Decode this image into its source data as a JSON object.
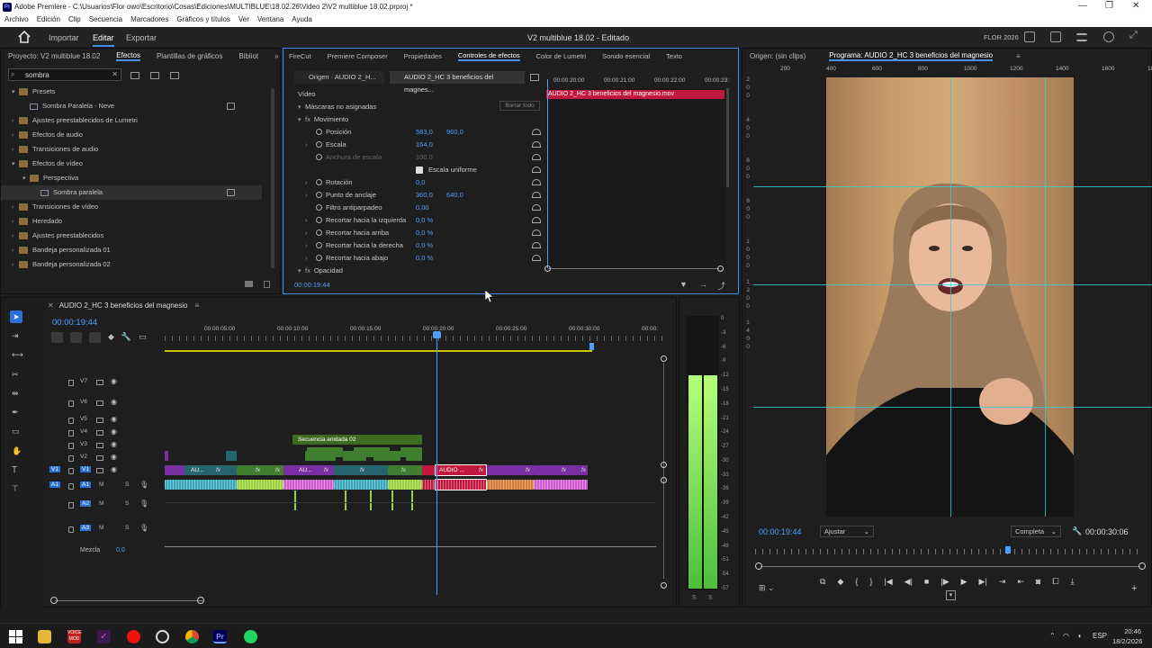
{
  "window": {
    "title": "Adobe Premiere - C:\\Usuarios\\Flor owo\\Escritorio\\Cosas\\Ediciones\\MULTIBLUE\\18.02.26\\Video 2\\V2 multiblue 18.02.prproj *"
  },
  "menu": [
    "Archivo",
    "Edición",
    "Clip",
    "Secuencia",
    "Marcadores",
    "Gráficos y títulos",
    "Ver",
    "Ventana",
    "Ayuda"
  ],
  "workspace": {
    "import": "Importar",
    "edit": "Editar",
    "export": "Exportar",
    "project_title": "V2 multiblue 18.02 - Editado",
    "user": "FLOR 2026"
  },
  "effects_panel": {
    "tabs": [
      "Proyecto: V2 multiblue 18.02",
      "Efectos",
      "Plantillas de gráficos",
      "Bibliot"
    ],
    "search": "sombra",
    "tree": [
      {
        "label": "Presets",
        "kind": "folder",
        "open": true,
        "indent": 0
      },
      {
        "label": "Sombra Paralela - Neve",
        "kind": "preset",
        "indent": 1
      },
      {
        "label": "Ajustes preestablecidos de Lumetri",
        "kind": "folder",
        "indent": 0
      },
      {
        "label": "Efectos de audio",
        "kind": "folder",
        "indent": 0
      },
      {
        "label": "Transiciones de audio",
        "kind": "folder",
        "indent": 0
      },
      {
        "label": "Efectos de vídeo",
        "kind": "folder",
        "open": true,
        "indent": 0
      },
      {
        "label": "Perspectiva",
        "kind": "folder",
        "open": true,
        "indent": 1
      },
      {
        "label": "Sombra paralela",
        "kind": "preset",
        "indent": 2,
        "selected": true
      },
      {
        "label": "Transiciones de vídeo",
        "kind": "folder",
        "indent": 0
      },
      {
        "label": "Heredado",
        "kind": "folder",
        "indent": 0
      },
      {
        "label": "Ajustes preestablecidos",
        "kind": "folder",
        "indent": 0
      },
      {
        "label": "Bandeja personalizada 01",
        "kind": "folder",
        "indent": 0
      },
      {
        "label": "Bandeja personalizada 02",
        "kind": "folder",
        "indent": 0
      }
    ]
  },
  "effect_controls": {
    "tabs": [
      "FireCut",
      "Premiere Composer",
      "Propiedades",
      "Controles de efectos",
      "Color de Lumetri",
      "Sonido esencial",
      "Texto"
    ],
    "source_tab": "Origen · AUDIO 2_H...",
    "seq_tab": "AUDIO 2_HC 3 beneficios del magnes...",
    "video_label": "Vídeo",
    "masks": "Máscaras no asignadas",
    "clear": "Borrar todo",
    "motion": "Movimiento",
    "rows": [
      {
        "label": "Posición",
        "v1": "583,0",
        "v2": "960,0"
      },
      {
        "label": "Escala",
        "v1": "164,0"
      },
      {
        "label": "Anchura de escala",
        "v1": "100,0",
        "disabled": true
      },
      {
        "label": "Escala uniforme",
        "checkbox": true
      },
      {
        "label": "Rotación",
        "v1": "0,0"
      },
      {
        "label": "Punto de anclaje",
        "v1": "360,0",
        "v2": "640,0"
      },
      {
        "label": "Filtro antiparpadeo",
        "v1": "0,00"
      },
      {
        "label": "Recortar hacia la izquierda",
        "v1": "0,0 %"
      },
      {
        "label": "Recortar hacia arriba",
        "v1": "0,0 %"
      },
      {
        "label": "Recortar hacia la derecha",
        "v1": "0,0 %"
      },
      {
        "label": "Recortar hacia abajo",
        "v1": "0,0 %"
      }
    ],
    "opacity": "Opacidad",
    "timecode": "00:00:19:44",
    "mini_ruler": [
      "00:00:20:00",
      "00:00:21:00",
      "00:00:22:00",
      "00:00:23:"
    ],
    "clip_name": "AUDIO 2_HC 3 beneficios del magnesio.mov"
  },
  "program": {
    "tabs": [
      "Origen: (sin clips)",
      "Programa: AUDIO 2_HC 3 beneficios del magnesio"
    ],
    "ruler": [
      "200",
      "400",
      "600",
      "800",
      "1000",
      "1200",
      "1400",
      "1600",
      "1800"
    ],
    "timecode": "00:00:19:44",
    "fit": "Ajustar",
    "quality": "Completa",
    "duration": "00:00:30:06"
  },
  "timeline": {
    "seq_name": "AUDIO 2_HC 3 beneficios del magnesio",
    "timecode": "00:00:19:44",
    "ruler": [
      "00:00:05:00",
      "00:00:10:00",
      "00:00:15:00",
      "00:00:20:00",
      "00:00:25:00",
      "00:00:30:00",
      "00:00:"
    ],
    "tracks": [
      "V7",
      "V6",
      "V5",
      "V4",
      "V3",
      "V2",
      "V1",
      "A1",
      "A2",
      "A3"
    ],
    "mix_label": "Mezcla",
    "mix_val": "0,0",
    "nested": "Secuencia anidada 02",
    "clip_a": "AU...",
    "clip_b": "AU...",
    "clip_sel": "AUDIO ...",
    "fx": "fx"
  },
  "meters": {
    "db": [
      "0",
      "-3",
      "-6",
      "-9",
      "-12",
      "-15",
      "-18",
      "-21",
      "-24",
      "-27",
      "-30",
      "-33",
      "-36",
      "-39",
      "-42",
      "-45",
      "-48",
      "-51",
      "-54",
      "-57"
    ],
    "level_db": -12
  },
  "taskbar": {
    "lang": "ESP",
    "time": "20:46",
    "date": "18/2/2026"
  },
  "colors": {
    "accent": "#4ea0ff",
    "v_purple": "#7a2ea3",
    "v_green": "#3f7f2f",
    "v_teal": "#27656e",
    "a_cyan": "#36a7b8",
    "a_pink": "#d15ad0",
    "a_lime": "#9ad13a",
    "a_orange": "#d47a34",
    "sel_red": "#c2183f"
  }
}
